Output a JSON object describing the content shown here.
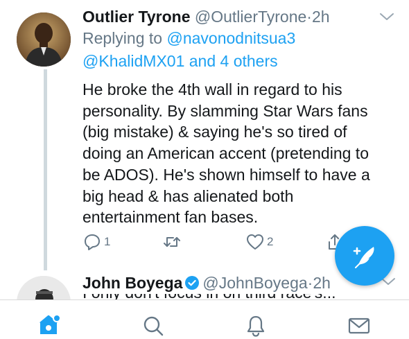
{
  "tweet": {
    "display_name": "Outlier Tyrone",
    "handle": "@OutlierTyrone",
    "separator": "·",
    "time": "2h",
    "replying_to_prefix": "Replying to",
    "replying_to_first": "@navonodnitsua3",
    "replying_to_second": "@KhalidMX01",
    "replying_to_and": "and",
    "replying_to_others": "4 others",
    "body_lines": [
      "He broke the 4th wall in regard to his",
      "personality. By slamming Star Wars fans",
      "(big mistake) & saying he's so tired of",
      "doing an American accent (pretending to",
      "be ADOS). He's shown himself to have a",
      "big head & has alienated both",
      "entertainment fan bases."
    ],
    "reply_count": "1",
    "retweet_count": "",
    "like_count": "2"
  },
  "next_tweet": {
    "display_name": "John Boyega",
    "handle": "@JohnBoyega",
    "separator": "·",
    "time": "2h",
    "body_partial": "I only don't focus in on third race's..."
  },
  "tabbar": {
    "icons": [
      "home-icon",
      "search-icon",
      "notifications-icon",
      "messages-icon"
    ],
    "active": "home"
  },
  "colors": {
    "accent": "#1da1f2",
    "secondary_text": "#657786",
    "primary_text": "#14171a",
    "verified": "#1da1f2",
    "thread_line": "#cfd9de"
  }
}
